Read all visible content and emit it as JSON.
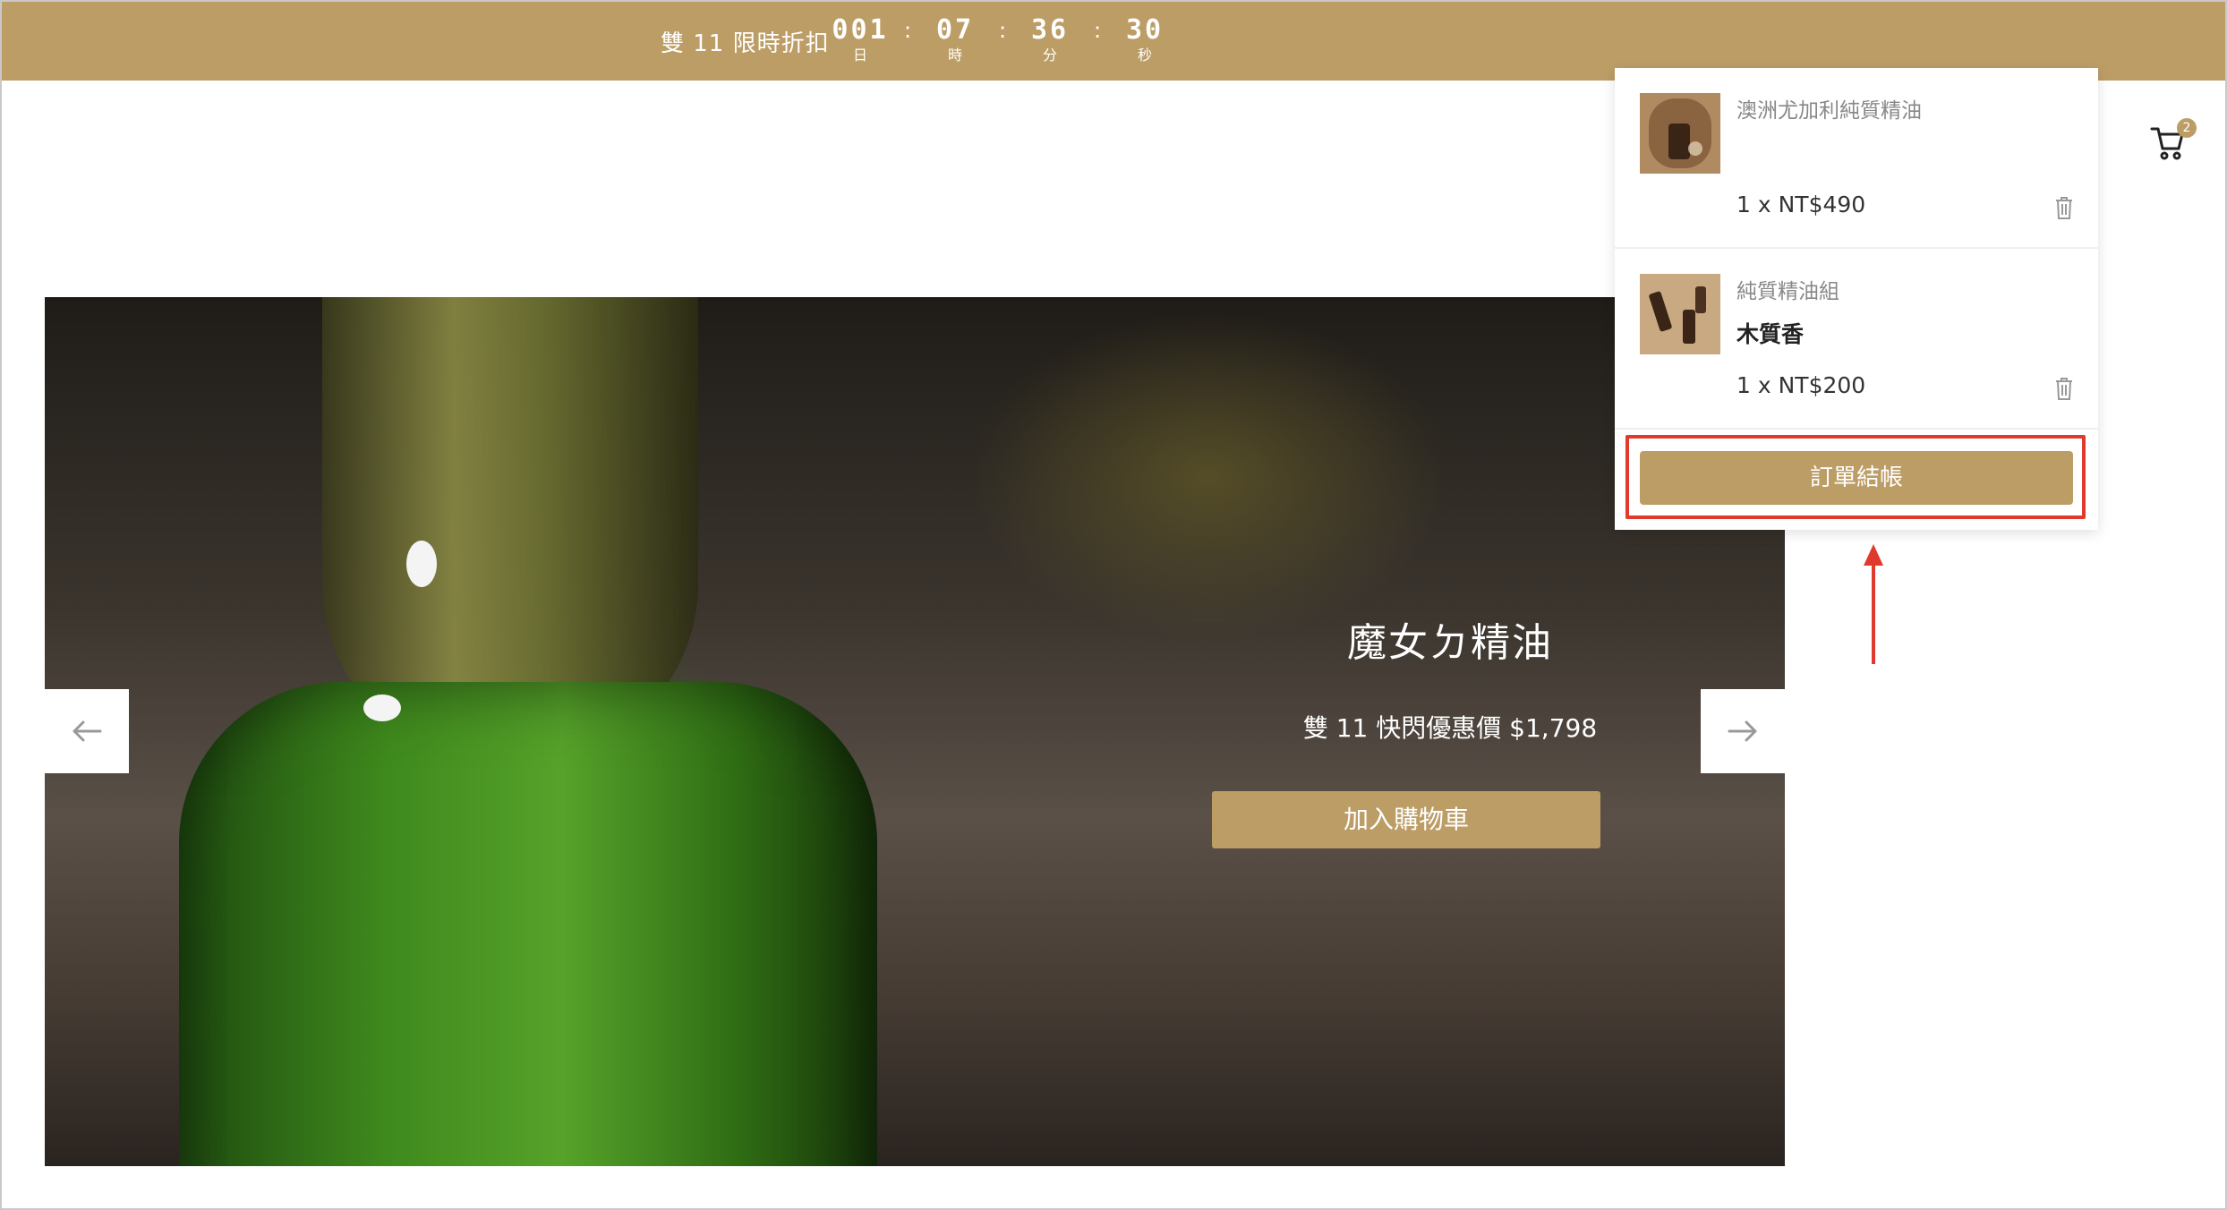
{
  "topbar": {
    "promo_label": "雙 11 限時折扣",
    "countdown": [
      {
        "value": "001",
        "unit": "日"
      },
      {
        "value": "07",
        "unit": "時"
      },
      {
        "value": "36",
        "unit": "分"
      },
      {
        "value": "30",
        "unit": "秒"
      }
    ],
    "separator": ":"
  },
  "header": {
    "cart_count": "2",
    "cart_icon": "cart-icon"
  },
  "hero": {
    "title": "魔女ㄉ精油",
    "price": "雙 11 快閃優惠價 $1,798",
    "add_to_cart_label": "加入購物車",
    "prev_arrow": "←",
    "next_arrow": "→"
  },
  "cart_dropdown": {
    "items": [
      {
        "name": "澳洲尤加利純質精油",
        "variant": "",
        "qty_price": "1 x  NT$490"
      },
      {
        "name": "純質精油組",
        "variant": "木質香",
        "qty_price": "1 x  NT$200"
      }
    ],
    "checkout_label": "訂單結帳"
  },
  "colors": {
    "brand_gold": "#bc9d66",
    "annotation_red": "#e03a2f"
  }
}
